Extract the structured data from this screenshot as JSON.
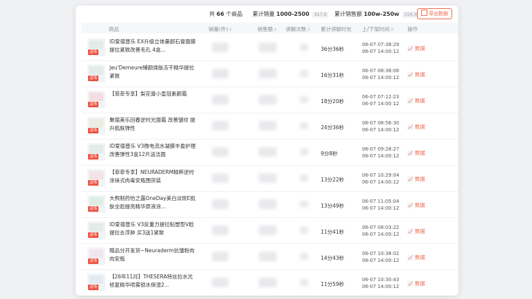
{
  "summary": {
    "count_prefix": "共",
    "count_value": "66",
    "count_suffix": "个商品",
    "sales_label": "累计销量",
    "sales_range": "1000-2500",
    "sales_sub": "617.9",
    "revenue_label": "累计销售额",
    "revenue_range": "100w-250w",
    "revenue_sub": "154,387",
    "export_label": "导出数据"
  },
  "columns": [
    "商品",
    "销量(件)",
    "销售额",
    "讲解次数",
    "累计讲解时长",
    "上/下架时间",
    "操作"
  ],
  "tag_label": "返场",
  "action_label": "数据",
  "rows": [
    {
      "name": "ID爱德普乐 EX升级立体量颜石膏面膜提拉紧致改善毛孔 4盒...",
      "duration": "36分36秒",
      "on": "06-07  07:38:29",
      "off": "06-07  14:00:12"
    },
    {
      "name": "Jeu'Demeure臻颜焕肤冻干精华提拉紧致",
      "duration": "16分31秒",
      "on": "06-07  08:36:08",
      "off": "06-07  14:00:12"
    },
    {
      "name": "【菲菲专享】梨花膏小皇冠素颜霜",
      "duration": "18分20秒",
      "on": "06-07  07:12:23",
      "off": "06-07  14:00:12"
    },
    {
      "name": "聚德美乐回春逆时光面霜 改善皱纹 提升肌肤弹性",
      "duration": "24分36秒",
      "on": "06-07  08:56:30",
      "off": "06-07  14:00:12"
    },
    {
      "name": "ID爱德普乐 V3微电流水凝膜丰盈护理改善弹性3盒12片送洁面",
      "duration": "9分8秒",
      "on": "06-07  09:28:27",
      "off": "06-07  14:00:12"
    },
    {
      "name": "【菲菲专享】NEURADERM精粹逆时涂抹式肉毒安瓶围货装",
      "duration": "13分22秒",
      "on": "06-07  10:29:04",
      "off": "06-07  14:00:12"
    },
    {
      "name": "大熊制药怡之露OneDay美白淡斑E肌肤全脸提亮精华原液涂...",
      "duration": "13分49秒",
      "on": "06-07  11:05:04",
      "off": "06-07  14:00:12"
    },
    {
      "name": "ID爱德普乐 V3反重力提拉贴塑型V脸提拉去浮肿 买3送1紧致",
      "duration": "11分41秒",
      "on": "06-07  08:03:22",
      "off": "06-07  14:00:12"
    },
    {
      "name": "赠品分开发货~Neuraderm抗皱粉肉肉安瓶",
      "duration": "14分43秒",
      "on": "06-07  10:38:02",
      "off": "06-07  14:00:12"
    },
    {
      "name": "【26年11月】THESERA特丝拉水光修复精华喷雾锁水保湿2...",
      "duration": "11分59秒",
      "on": "06-07  10:30:43",
      "off": "06-07  14:00:12"
    }
  ]
}
